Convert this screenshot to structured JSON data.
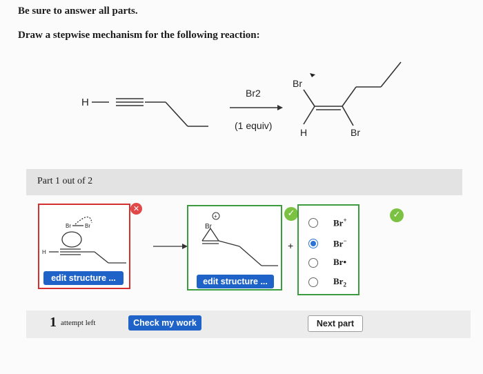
{
  "question": {
    "instruction": "Be sure to answer all parts.",
    "prompt": "Draw a stepwise mechanism for the following reaction:"
  },
  "reaction": {
    "reactant_h": "H",
    "reagent": "Br2",
    "conditions": "(1 equiv)",
    "product_br_top": "Br",
    "product_h": "H",
    "product_br_right": "Br"
  },
  "part": {
    "label": "Part 1 out of 2"
  },
  "structures": {
    "left_box": {
      "br1": "Br",
      "br2": "Br",
      "h": "H",
      "edit_label": "edit structure ..."
    },
    "right_box": {
      "charge": "+",
      "br": "Br",
      "edit_label": "edit structure ..."
    },
    "plus": "+"
  },
  "options": [
    {
      "label": "Br+",
      "selected": false
    },
    {
      "label": "Br−",
      "selected": true
    },
    {
      "label": "Br•",
      "selected": false
    },
    {
      "label": "Br2",
      "selected": false
    }
  ],
  "footer": {
    "attempts_count": "1",
    "attempts_text": "attempt left",
    "check_button": "Check my work",
    "next_button": "Next part"
  },
  "colors": {
    "primary_button": "#1f63c8",
    "correct": "#7cc242",
    "wrong": "#e14848",
    "selected_radio": "#2a72d4"
  }
}
